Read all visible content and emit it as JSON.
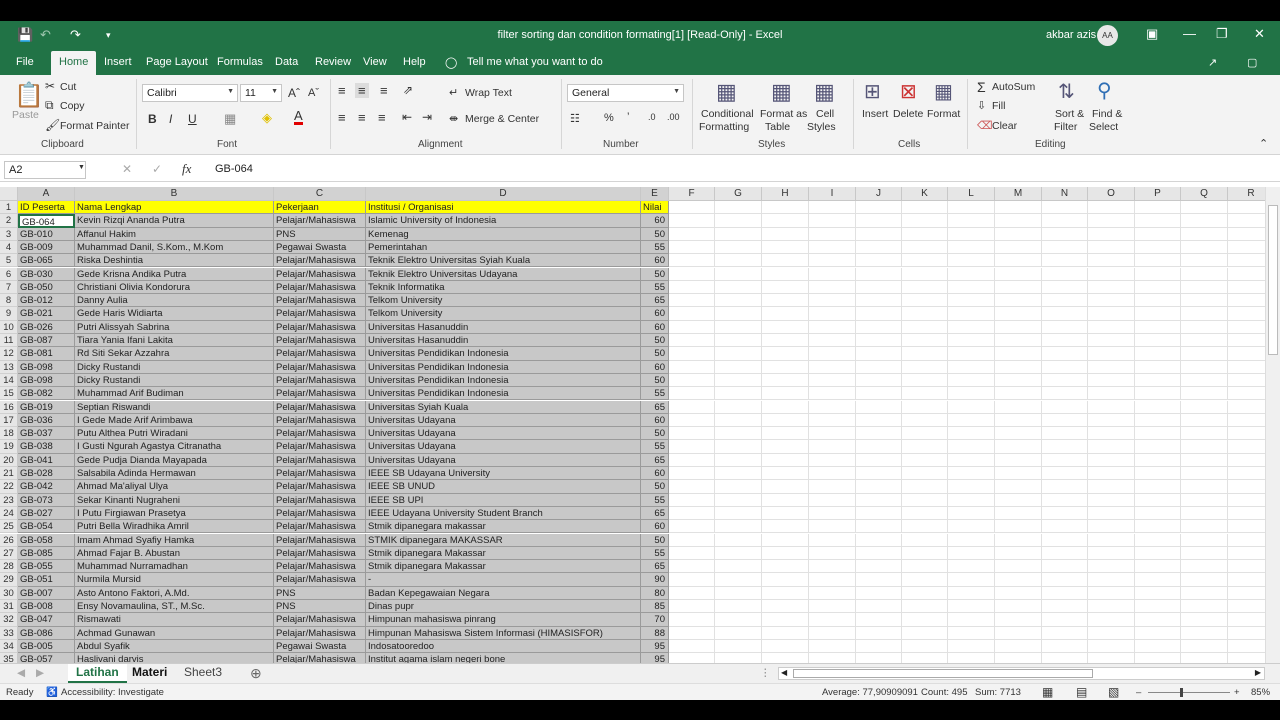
{
  "window": {
    "title": "filter sorting dan condition formating[1]  [Read-Only]  -  Excel",
    "user": "akbar azis",
    "avatar_initials": "AA"
  },
  "menu": [
    "File",
    "Home",
    "Insert",
    "Page Layout",
    "Formulas",
    "Data",
    "Review",
    "View",
    "Help"
  ],
  "tell_me": "Tell me what you want to do",
  "ribbon": {
    "clipboard": {
      "paste": "Paste",
      "cut": "Cut",
      "copy": "Copy",
      "format_painter": "Format Painter",
      "label": "Clipboard"
    },
    "font": {
      "name": "Calibri",
      "size": "11",
      "label": "Font"
    },
    "alignment": {
      "wrap": "Wrap Text",
      "merge": "Merge & Center",
      "label": "Alignment"
    },
    "number": {
      "format": "General",
      "label": "Number"
    },
    "styles": {
      "cond1": "Conditional",
      "cond2": "Formatting",
      "fmt1": "Format as",
      "fmt2": "Table",
      "cell1": "Cell",
      "cell2": "Styles",
      "label": "Styles"
    },
    "cells": {
      "insert": "Insert",
      "delete": "Delete",
      "format": "Format",
      "label": "Cells"
    },
    "editing": {
      "autosum": "AutoSum",
      "fill": "Fill",
      "clear": "Clear",
      "sort1": "Sort &",
      "sort2": "Filter",
      "find1": "Find &",
      "find2": "Select",
      "label": "Editing"
    }
  },
  "formula_bar": {
    "name_box": "A2",
    "formula": "GB-064"
  },
  "columns": [
    "A",
    "B",
    "C",
    "D",
    "E",
    "F",
    "G",
    "H",
    "I",
    "J",
    "K",
    "L",
    "M",
    "N",
    "O",
    "P",
    "Q",
    "R"
  ],
  "header_row": [
    "ID Peserta",
    "Nama Lengkap",
    "Pekerjaan",
    "Institusi / Organisasi",
    "Nilai"
  ],
  "rows": [
    [
      "GB-064",
      "Kevin Rizqi Ananda Putra",
      "Pelajar/Mahasiswa",
      "Islamic University of Indonesia",
      "60"
    ],
    [
      "GB-010",
      "Affanul Hakim",
      "PNS",
      "Kemenag",
      "50"
    ],
    [
      "GB-009",
      "Muhammad Danil, S.Kom., M.Kom",
      "Pegawai Swasta",
      "Pemerintahan",
      "55"
    ],
    [
      "GB-065",
      "Riska Deshintia",
      "Pelajar/Mahasiswa",
      "Teknik Elektro Universitas Syiah Kuala",
      "60"
    ],
    [
      "GB-030",
      "Gede Krisna Andika Putra",
      "Pelajar/Mahasiswa",
      "Teknik Elektro Universitas Udayana",
      "50"
    ],
    [
      "GB-050",
      "Christiani Olivia Kondorura",
      "Pelajar/Mahasiswa",
      "Teknik Informatika",
      "55"
    ],
    [
      "GB-012",
      "Danny Aulia",
      "Pelajar/Mahasiswa",
      "Telkom University",
      "65"
    ],
    [
      "GB-021",
      "Gede Haris Widiarta",
      "Pelajar/Mahasiswa",
      "Telkom University",
      "60"
    ],
    [
      "GB-026",
      "Putri Alissyah Sabrina",
      "Pelajar/Mahasiswa",
      "Universitas Hasanuddin",
      "60"
    ],
    [
      "GB-087",
      "Tiara Yania Ifani Lakita",
      "Pelajar/Mahasiswa",
      "Universitas Hasanuddin",
      "50"
    ],
    [
      "GB-081",
      "Rd Siti Sekar Azzahra",
      "Pelajar/Mahasiswa",
      "Universitas Pendidikan Indonesia",
      "50"
    ],
    [
      "GB-098",
      "Dicky Rustandi",
      "Pelajar/Mahasiswa",
      "Universitas Pendidikan Indonesia",
      "60"
    ],
    [
      "GB-098",
      "Dicky Rustandi",
      "Pelajar/Mahasiswa",
      "Universitas Pendidikan Indonesia",
      "50"
    ],
    [
      "GB-082",
      "Muhammad Arif Budiman",
      "Pelajar/Mahasiswa",
      "Universitas Pendidikan Indonesia",
      "55"
    ],
    [
      "GB-019",
      "Septian Riswandi",
      "Pelajar/Mahasiswa",
      "Universitas Syiah Kuala",
      "65"
    ],
    [
      "GB-036",
      "I Gede Made Arif Arimbawa",
      "Pelajar/Mahasiswa",
      "Universitas Udayana",
      "60"
    ],
    [
      "GB-037",
      "Putu Althea Putri Wiradani",
      "Pelajar/Mahasiswa",
      "Universitas Udayana",
      "50"
    ],
    [
      "GB-038",
      "I Gusti Ngurah Agastya Citranatha",
      "Pelajar/Mahasiswa",
      "Universitas Udayana",
      "55"
    ],
    [
      "GB-041",
      "Gede Pudja Dianda Mayapada",
      "Pelajar/Mahasiswa",
      "Universitas Udayana",
      "65"
    ],
    [
      "GB-028",
      "Salsabila Adinda Hermawan",
      "Pelajar/Mahasiswa",
      "IEEE SB Udayana University",
      "60"
    ],
    [
      "GB-042",
      "Ahmad Ma'aliyal Ulya",
      "Pelajar/Mahasiswa",
      "IEEE SB UNUD",
      "50"
    ],
    [
      "GB-073",
      "Sekar Kinanti Nugraheni",
      "Pelajar/Mahasiswa",
      "IEEE SB UPI",
      "55"
    ],
    [
      "GB-027",
      "I Putu Firgiawan Prasetya",
      "Pelajar/Mahasiswa",
      "IEEE Udayana University Student Branch",
      "65"
    ],
    [
      "GB-054",
      "Putri Bella Wiradhika Amril",
      "Pelajar/Mahasiswa",
      "Stmik dipanegara makassar",
      "60"
    ],
    [
      "GB-058",
      "Imam Ahmad Syafiy Hamka",
      "Pelajar/Mahasiswa",
      "STMIK dipanegara MAKASSAR",
      "50"
    ],
    [
      "GB-085",
      "Ahmad Fajar B. Abustan",
      "Pelajar/Mahasiswa",
      "Stmik dipanegara Makassar",
      "55"
    ],
    [
      "GB-055",
      "Muhammad Nurramadhan",
      "Pelajar/Mahasiswa",
      "Stmik dipanegara Makassar",
      "65"
    ],
    [
      "GB-051",
      "Nurmila Mursid",
      "Pelajar/Mahasiswa",
      "-",
      "90"
    ],
    [
      "GB-007",
      "Asto Antono Faktori, A.Md.",
      "PNS",
      "Badan Kepegawaian Negara",
      "80"
    ],
    [
      "GB-008",
      "Ensy Novamaulina, ST., M.Sc.",
      "PNS",
      "Dinas pupr",
      "85"
    ],
    [
      "GB-047",
      "Rismawati",
      "Pelajar/Mahasiswa",
      "Himpunan mahasiswa pinrang",
      "70"
    ],
    [
      "GB-086",
      "Achmad Gunawan",
      "Pelajar/Mahasiswa",
      "Himpunan Mahasiswa Sistem Informasi (HIMASISFOR)",
      "88"
    ],
    [
      "GB-005",
      "Abdul Syafik",
      "Pegawai Swasta",
      "Indosatooredoo",
      "95"
    ],
    [
      "GB-057",
      "Haslivani darvis",
      "Pelajar/Mahasiswa",
      "Institut agama islam negeri bone",
      "95"
    ]
  ],
  "sheets": [
    "Latihan",
    "Materi",
    "Sheet3"
  ],
  "status": {
    "ready": "Ready",
    "accessibility": "Accessibility: Investigate",
    "average": "Average: 77,90909091",
    "count": "Count: 495",
    "sum": "Sum: 7713",
    "zoom": "85%"
  }
}
